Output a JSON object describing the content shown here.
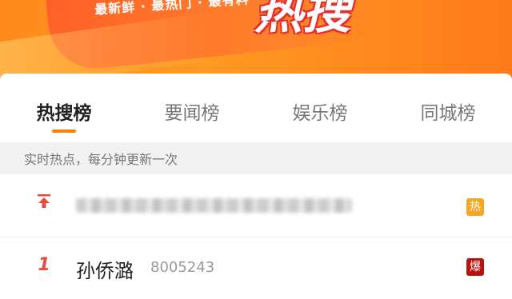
{
  "banner": {
    "tagline": "最新鲜 · 最热门 · 最有料",
    "logo_text": "热搜"
  },
  "tabs": [
    {
      "label": "热搜榜",
      "active": true
    },
    {
      "label": "要闻榜",
      "active": false
    },
    {
      "label": "娱乐榜",
      "active": false
    },
    {
      "label": "同城榜",
      "active": false
    }
  ],
  "info": "实时热点，每分钟更新一次",
  "list": [
    {
      "rank_icon": "pin-top-icon",
      "title": "",
      "badge": "热",
      "badge_color": "#f5a623"
    },
    {
      "rank": "1",
      "title": "孙侨潞",
      "count": "8005243",
      "badge": "爆",
      "badge_color": "#b8120f"
    }
  ],
  "colors": {
    "accent": "#ff8200",
    "rank": "#e84b3b"
  }
}
